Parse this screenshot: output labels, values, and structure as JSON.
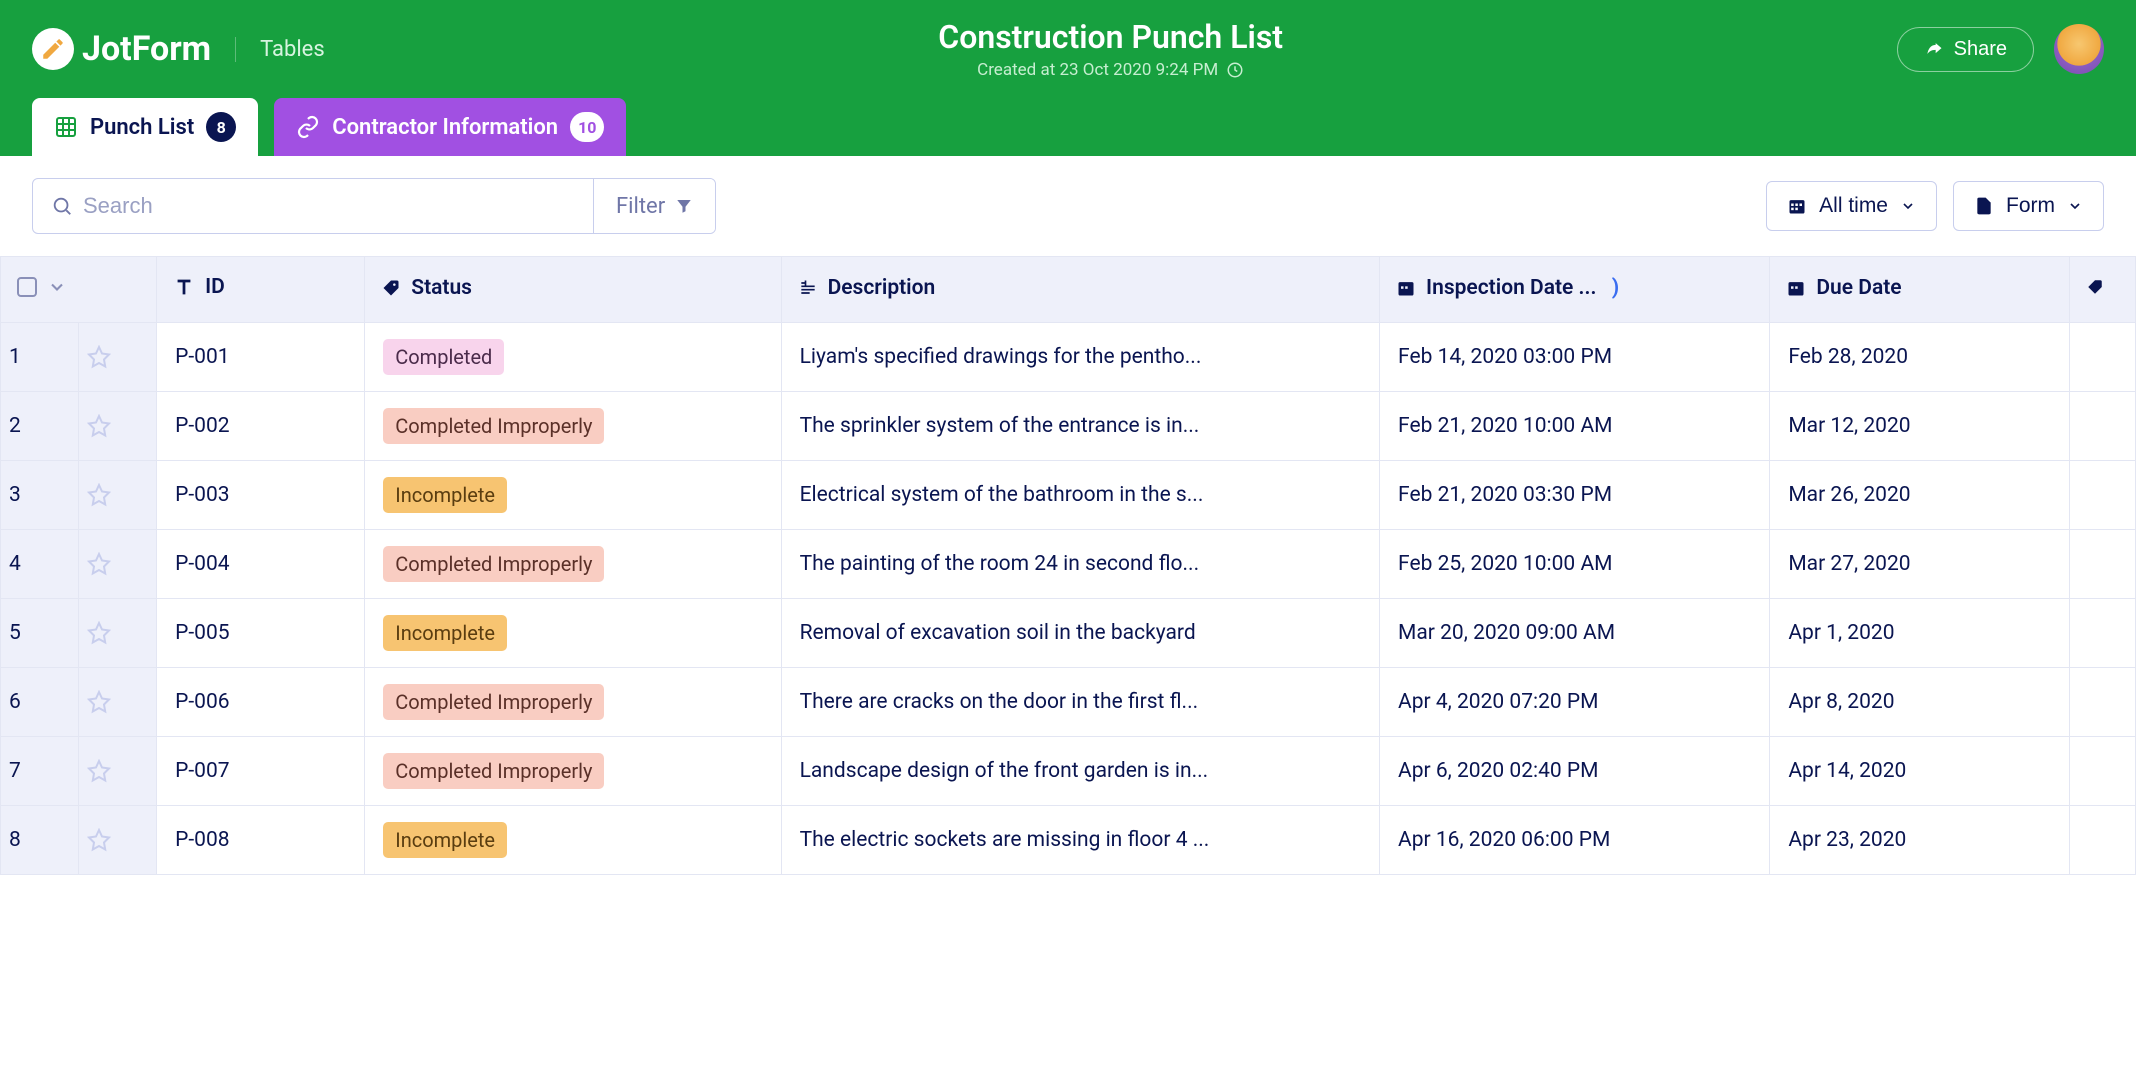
{
  "header": {
    "brand": "JotForm",
    "app_label": "Tables",
    "title": "Construction Punch List",
    "subtitle": "Created at 23 Oct 2020 9:24 PM",
    "share_label": "Share"
  },
  "tabs": [
    {
      "label": "Punch List",
      "count": "8",
      "active": true
    },
    {
      "label": "Contractor Information",
      "count": "10",
      "active": false
    }
  ],
  "toolbar": {
    "search_placeholder": "Search",
    "filter_label": "Filter",
    "time_label": "All time",
    "form_label": "Form"
  },
  "columns": {
    "id": "ID",
    "status": "Status",
    "description": "Description",
    "inspection": "Inspection Date ...",
    "due": "Due Date"
  },
  "rows": [
    {
      "idx": "1",
      "id": "P-001",
      "status": "Completed",
      "description": "Liyam's specified drawings for the pentho...",
      "inspection": "Feb 14, 2020 03:00 PM",
      "due": "Feb 28, 2020"
    },
    {
      "idx": "2",
      "id": "P-002",
      "status": "Completed Improperly",
      "description": "The sprinkler system of the entrance is in...",
      "inspection": "Feb 21, 2020 10:00 AM",
      "due": "Mar 12, 2020"
    },
    {
      "idx": "3",
      "id": "P-003",
      "status": "Incomplete",
      "description": "Electrical system of the bathroom in the s...",
      "inspection": "Feb 21, 2020 03:30 PM",
      "due": "Mar 26, 2020"
    },
    {
      "idx": "4",
      "id": "P-004",
      "status": "Completed Improperly",
      "description": "The painting of the room 24 in second flo...",
      "inspection": "Feb 25, 2020 10:00 AM",
      "due": "Mar 27, 2020"
    },
    {
      "idx": "5",
      "id": "P-005",
      "status": "Incomplete",
      "description": "Removal of excavation soil in the backyard",
      "inspection": "Mar 20, 2020 09:00 AM",
      "due": "Apr 1, 2020"
    },
    {
      "idx": "6",
      "id": "P-006",
      "status": "Completed Improperly",
      "description": "There are cracks on the door in the first fl...",
      "inspection": "Apr 4, 2020 07:20 PM",
      "due": "Apr 8, 2020"
    },
    {
      "idx": "7",
      "id": "P-007",
      "status": "Completed Improperly",
      "description": "Landscape design of the front garden is in...",
      "inspection": "Apr 6, 2020 02:40 PM",
      "due": "Apr 14, 2020"
    },
    {
      "idx": "8",
      "id": "P-008",
      "status": "Incomplete",
      "description": "The electric sockets are missing in floor 4 ...",
      "inspection": "Apr 16, 2020 06:00 PM",
      "due": "Apr 23, 2020"
    }
  ]
}
